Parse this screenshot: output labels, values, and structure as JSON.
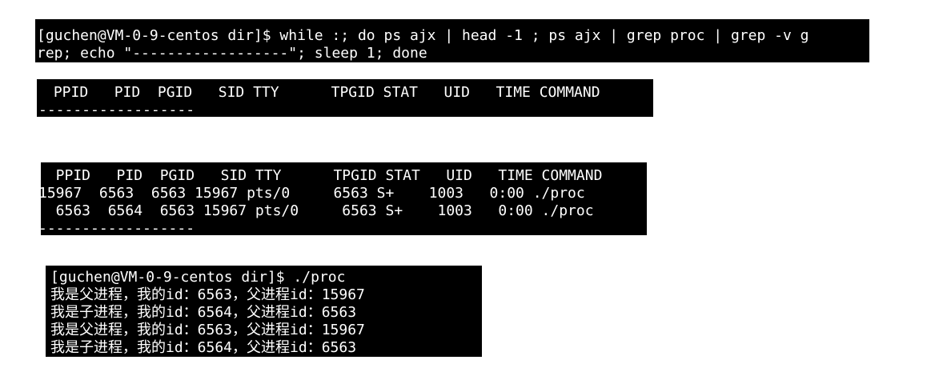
{
  "command_panel": {
    "tail_char": "~",
    "line1": "[guchen@VM-0-9-centos dir]$ while :; do ps ajx | head -1 ; ps ajx | grep proc | grep -v g",
    "line2": "rep; echo \"------------------\"; sleep 1; done"
  },
  "ps_snapshot_1": {
    "header": " PPID   PID  PGID   SID TTY      TPGID STAT   UID   TIME COMMAND",
    "separator": "------------------"
  },
  "ps_snapshot_2": {
    "header": "  PPID   PID  PGID   SID TTY      TPGID STAT   UID   TIME COMMAND",
    "rows": [
      "15967  6563  6563 15967 pts/0     6563 S+    1003   0:00 ./proc",
      "  6563  6564  6563 15967 pts/0     6563 S+    1003   0:00 ./proc"
    ],
    "separator": "------------------"
  },
  "output_panel": {
    "prompt": "[guchen@VM-0-9-centos dir]$ ./proc",
    "lines": [
      "我是父进程，我的id：6563，父进程id：15967",
      "我是子进程，我的id：6564，父进程id：6563",
      "我是父进程，我的id：6563，父进程id：15967",
      "我是子进程，我的id：6564，父进程id：6563"
    ]
  }
}
